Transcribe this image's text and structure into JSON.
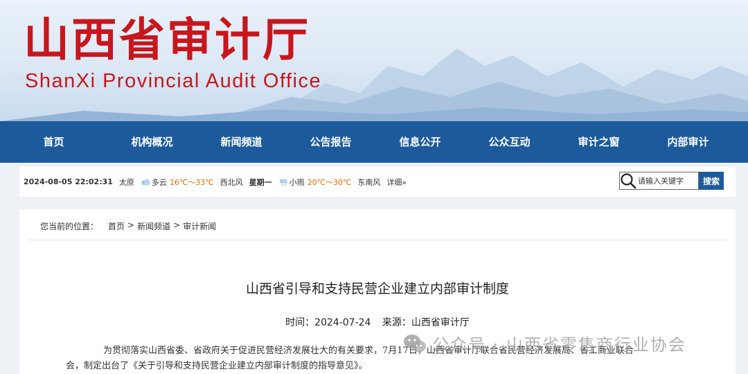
{
  "banner": {
    "title": "山西省审计厅",
    "subtitle": "ShanXi Provincial Audit Office"
  },
  "nav": {
    "items": [
      "首页",
      "机构概况",
      "新闻频道",
      "公告报告",
      "信息公开",
      "公众互动",
      "审计之窗",
      "内部审计"
    ]
  },
  "infobar": {
    "datetime": "2024-08-05 22:02:31",
    "city": "太原",
    "today": {
      "weather": "多云",
      "temp": "16℃～33℃",
      "wind": "西北风"
    },
    "weekday": "星期一",
    "tomorrow": {
      "weather": "小雨",
      "temp": "20℃～30℃",
      "wind": "东南风"
    },
    "detail_link": "详细»"
  },
  "search": {
    "placeholder": "请输入关键字",
    "button_label": "搜索"
  },
  "breadcrumb": {
    "prefix": "您当前的位置：",
    "items": [
      "首页",
      "新闻频道",
      "审计新闻"
    ],
    "separator": ">"
  },
  "article": {
    "title": "山西省引导和支持民营企业建立内部审计制度",
    "time_label": "时间：2024-07-24",
    "source_label": "来源：山西省审计厅",
    "para_line1": "为贯彻落实山西省委、省政府关于促进民营经济发展壮大的有关要求，7月17日，山西省审计厅联合省民营经济发展局、省工商业联合",
    "para_line2": "会，制定出台了《关于引导和支持民营企业建立内部审计制度的指导意见》。"
  },
  "watermark": {
    "text": "公众号 · 山西省零售商行业协会"
  },
  "colors": {
    "brand_red": "#c8161d",
    "nav_blue": "#1c5a9c",
    "temp_orange": "#e06a00"
  }
}
